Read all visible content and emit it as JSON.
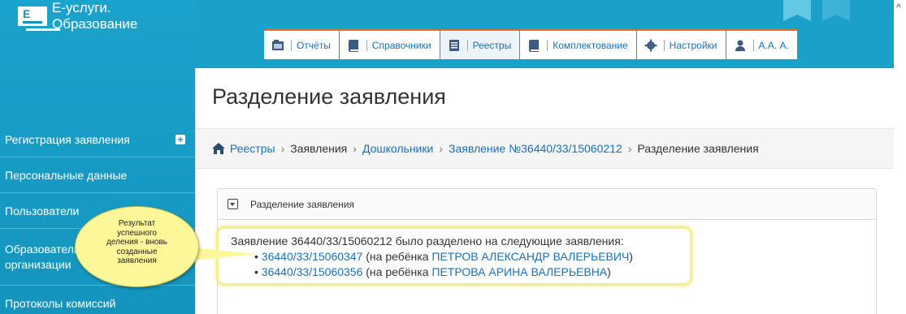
{
  "app": {
    "logo_line1": "Е-услуги.",
    "logo_line2": "Образование"
  },
  "tabs": [
    {
      "label": "Отчёты",
      "icon": "reports-icon"
    },
    {
      "label": "Справочники",
      "icon": "book-icon"
    },
    {
      "label": "Реестры",
      "icon": "document-icon",
      "active": true
    },
    {
      "label": "Комплектование",
      "icon": "book-icon"
    },
    {
      "label": "Настройки",
      "icon": "gear-icon"
    },
    {
      "label": "А.А. А.",
      "icon": "user-icon"
    }
  ],
  "sidebar": {
    "items": [
      {
        "label": "Регистрация заявления"
      },
      {
        "label": "Персональные данные"
      },
      {
        "label": "Пользователи"
      },
      {
        "label": "Образовательные организации"
      },
      {
        "label": "Протоколы комиссий"
      }
    ]
  },
  "page": {
    "title": "Разделение заявления"
  },
  "breadcrumb": {
    "items": [
      "Реестры",
      "Заявления",
      "Дошкольники",
      "Заявление №36440/33/15060212",
      "Разделение заявления"
    ]
  },
  "panel": {
    "title": "Разделение заявления",
    "intro": "Заявление 36440/33/15060212 было разделено на следующие заявления:",
    "results": [
      {
        "number": "36440/33/15060347",
        "mid": " (на ребёнка ",
        "child": "ПЕТРОВ АЛЕКСАНДР ВАЛЕРЬЕВИЧ",
        "end": ")"
      },
      {
        "number": "36440/33/15060356",
        "mid": " (на ребёнка ",
        "child": "ПЕТРОВА АРИНА ВАЛЕРЬЕВНА",
        "end": ")"
      }
    ]
  },
  "callout": {
    "lines": [
      "Результат",
      "успешного",
      "деления - вновь",
      "созданные",
      "заявления"
    ]
  },
  "colors": {
    "brand": "#1aa3cc",
    "accent": "#e96b2b",
    "link": "#1a6fb7"
  }
}
